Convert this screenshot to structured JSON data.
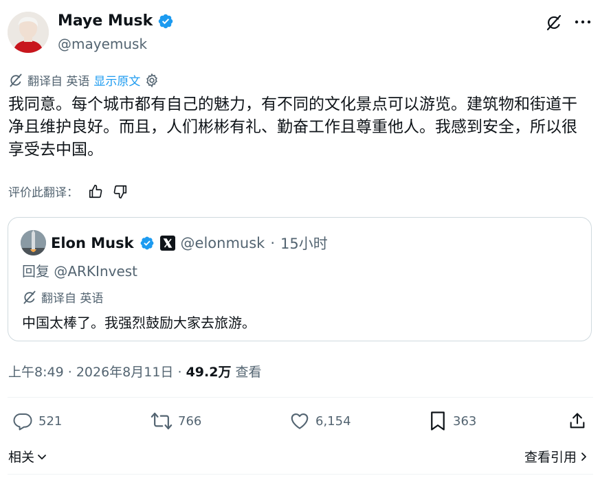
{
  "author": {
    "name": "Maye Musk",
    "handle": "@mayemusk"
  },
  "translation": {
    "translated_from": "翻译自 英语",
    "show_original": "显示原文"
  },
  "tweet_text": "我同意。每个城市都有自己的魅力，有不同的文化景点可以游览。建筑物和街道干净且维护良好。而且，人们彬彬有礼、勤奋工作且尊重他人。我感到安全，所以很享受去中国。",
  "rate_translation": "评价此翻译：",
  "quoted": {
    "name": "Elon Musk",
    "handle": "@elonmusk",
    "separator": "·",
    "time": "15小时",
    "reply_to": "回复 @ARKInvest",
    "translated_from": "翻译自 英语",
    "text": "中国太棒了。我强烈鼓励大家去旅游。"
  },
  "meta": {
    "time": "上午8:49",
    "sep1": "·",
    "date": "2026年8月11日",
    "sep2": "·",
    "views": "49.2万",
    "views_label": "查看"
  },
  "actions": {
    "replies": "521",
    "retweets": "766",
    "likes": "6,154",
    "bookmarks": "363"
  },
  "footer": {
    "related": "相关",
    "view_quotes": "查看引用"
  },
  "colors": {
    "verified_blue": "#1d9bf0",
    "secondary_text": "#536471",
    "primary_text": "#0f1419"
  },
  "icons": [
    "grok-icon",
    "more-icon",
    "translate-icon",
    "gear-icon",
    "thumbs-up-icon",
    "thumbs-down-icon",
    "verified-icon",
    "x-logo-icon",
    "reply-icon",
    "retweet-icon",
    "like-icon",
    "bookmark-icon",
    "share-icon",
    "chevron-down-icon",
    "chevron-right-icon"
  ]
}
